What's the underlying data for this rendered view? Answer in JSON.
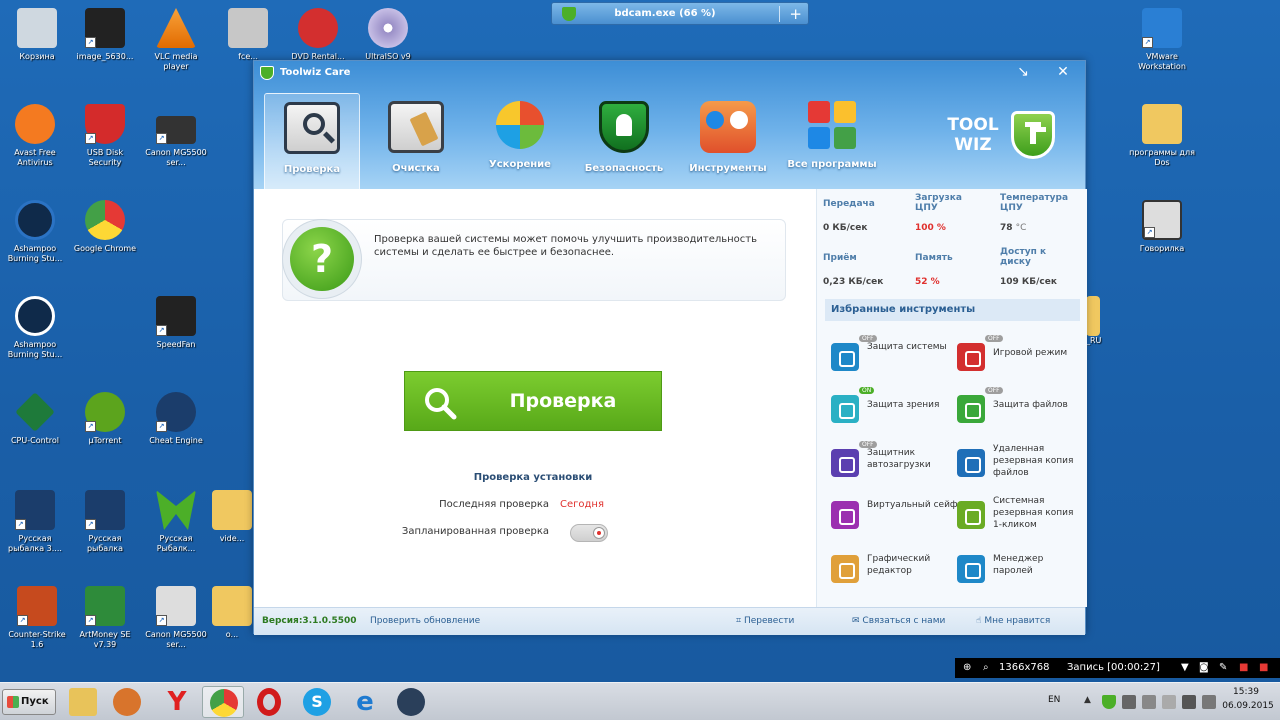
{
  "desktop": {
    "icons": [
      {
        "label": "Корзина",
        "color": "#cfd8e0"
      },
      {
        "label": "image_5630...",
        "color": "#222"
      },
      {
        "label": "VLC media player",
        "color": "#f07d00"
      },
      {
        "label": "fce...",
        "color": "#c7c7c7"
      },
      {
        "label": "DVD Rental...",
        "color": "#d32f2f"
      },
      {
        "label": "UltraISO v9",
        "color": "#9a8fc7"
      },
      {
        "label": "Avast Free Antivirus",
        "color": "#f47a20"
      },
      {
        "label": "USB Disk Security",
        "color": "#d42b2b"
      },
      {
        "label": "Canon MG5500 ser...",
        "color": "#333"
      },
      {
        "label": "Ashampoo Burning Stu...",
        "color": "#0f2a4a"
      },
      {
        "label": "Google Chrome",
        "color": "#4caf50"
      },
      {
        "label": "Ashampoo Burning Stu...",
        "color": "#0f2a4a"
      },
      {
        "label": "SpeedFan",
        "color": "#222"
      },
      {
        "label": "CPU-Control",
        "color": "#1e7a3a"
      },
      {
        "label": "µTorrent",
        "color": "#5ca41d"
      },
      {
        "label": "Cheat Engine",
        "color": "#1b3d6b"
      },
      {
        "label": "Русская рыбалка 3....",
        "color": "#1b3d6b"
      },
      {
        "label": "Русская рыбалка",
        "color": "#1b3d6b"
      },
      {
        "label": "Русская Рыбалк...",
        "color": "#4caf28"
      },
      {
        "label": "vide...",
        "color": "#f0c860"
      },
      {
        "label": "Counter-Strike 1.6",
        "color": "#c64a1e"
      },
      {
        "label": "ArtMoney SE v7.39",
        "color": "#2e8b3a"
      },
      {
        "label": "Canon MG5500 ser...",
        "color": "#ddd"
      },
      {
        "label": "o...",
        "color": "#f0c860"
      },
      {
        "label": "VMware Workstation",
        "color": "#2a7fd4"
      },
      {
        "label": "программы для Dos",
        "color": "#f0c860"
      },
      {
        "label": "Говорилка",
        "color": "#ddd"
      },
      {
        "label": "_RU",
        "color": "#f0c860"
      }
    ]
  },
  "topbar": {
    "title": "bdcam.exe (66 %)",
    "plus": "+"
  },
  "window": {
    "title": "Toolwiz Care",
    "controls": {
      "restore": "↘",
      "close": "✕"
    },
    "tabs": [
      {
        "label": "Проверка",
        "color": "#2d3a4a"
      },
      {
        "label": "Очистка",
        "color": "#3a3f46"
      },
      {
        "label": "Ускорение",
        "color": "#e7b23a"
      },
      {
        "label": "Безопасность",
        "color": "#1f8a2f"
      },
      {
        "label": "Инструменты",
        "color": "#e8652b"
      },
      {
        "label": "Все программы",
        "color": "#e53935"
      }
    ],
    "brand": {
      "line1": "TOOL",
      "line2": "WIZ"
    },
    "info_text": "Проверка вашей системы  может помочь улучшить производительность системы и сделать ее быстрее и безопаснее.",
    "qmark": "?",
    "scan_button": "Проверка",
    "install_check": "Проверка установки",
    "last_check_label": "Последняя проверка",
    "last_check_value": "Сегодня",
    "scheduled_label": "Запланированная проверка",
    "stats": {
      "send_label": "Передача",
      "send_value": "0 КБ/сек",
      "cpu_label": "Загрузка ЦПУ",
      "cpu_value": "100 %",
      "temp_label": "Температура ЦПУ",
      "temp_value": "78",
      "temp_unit": "°C",
      "recv_label": "Приём",
      "recv_value": "0,23 КБ/сек",
      "mem_label": "Память",
      "mem_value": "52 %",
      "disk_label": "Доступ к диску",
      "disk_value": "109 КБ/сек"
    },
    "favorites_header": "Избранные инструменты",
    "favorites": [
      {
        "label": "Защита системы",
        "color": "#1e88c8",
        "badge": "OFF",
        "on": false
      },
      {
        "label": "Игровой режим",
        "color": "#d32f2f",
        "badge": "OFF",
        "on": false
      },
      {
        "label": "Защита зрения",
        "color": "#2ab0c4",
        "badge": "ON",
        "on": true
      },
      {
        "label": "Защита файлов",
        "color": "#3aa83a",
        "badge": "OFF",
        "on": false
      },
      {
        "label": "Защитник автозагрузки",
        "color": "#5b3fb0",
        "badge": "OFF",
        "on": false
      },
      {
        "label": "Удаленная резервная копия файлов",
        "color": "#1f6fb8",
        "badge": "",
        "on": false
      },
      {
        "label": "Виртуальный сейф",
        "color": "#9b2fb0",
        "badge": "",
        "on": false
      },
      {
        "label": "Системная резервная копия 1-кликом",
        "color": "#6aab24",
        "badge": "",
        "on": false
      },
      {
        "label": "Графический редактор",
        "color": "#e0a03a",
        "badge": "",
        "on": false
      },
      {
        "label": "Менеджер паролей",
        "color": "#1e88c8",
        "badge": "",
        "on": false
      }
    ],
    "footer": {
      "version": "Версия:3.1.0.5500",
      "update": "Проверить обновление",
      "translate": "Перевести",
      "contact": "Связаться с нами",
      "like": "Мне нравится"
    }
  },
  "recorder": {
    "resolution": "1366x768",
    "record_label": "Запись [00:00:27]"
  },
  "taskbar": {
    "start": "Пуск",
    "apps": [
      {
        "name": "explorer",
        "color": "#e8c35a"
      },
      {
        "name": "media",
        "color": "#d8742c"
      },
      {
        "name": "yandex",
        "color": "#e02020"
      },
      {
        "name": "chrome",
        "color": "#4caf50"
      },
      {
        "name": "opera",
        "color": "#d11a1a"
      },
      {
        "name": "skype",
        "color": "#1ea0e4"
      },
      {
        "name": "ie",
        "color": "#1e7ad0"
      },
      {
        "name": "settings",
        "color": "#2a3f5a"
      }
    ],
    "lang": "EN",
    "time": "15:39",
    "date": "06.09.2015"
  }
}
